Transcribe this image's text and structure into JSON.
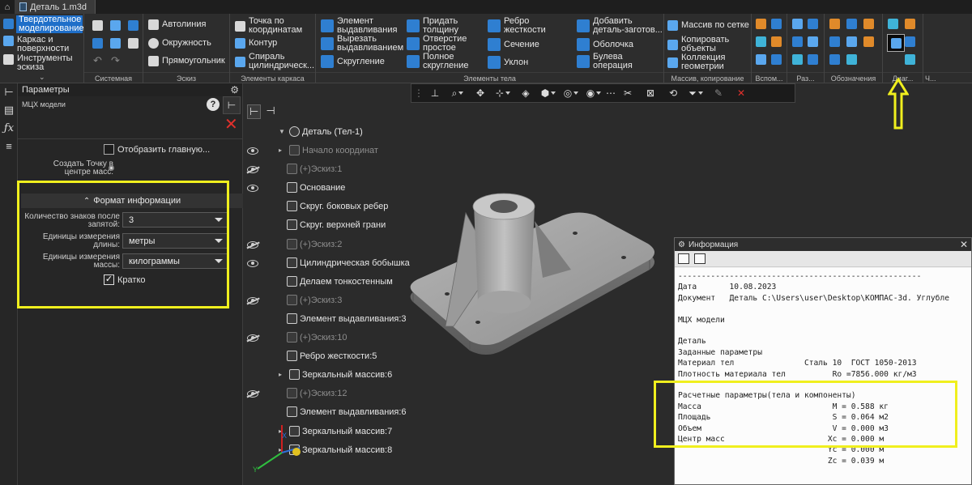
{
  "titlebar": {
    "tab": "Деталь 1.m3d"
  },
  "ribbon": {
    "mode": {
      "active": "Твердотельное моделирование",
      "items": [
        "Каркас и поверхности",
        "Инструменты эскиза"
      ]
    },
    "system": {
      "footer": "Системная"
    },
    "sketch": {
      "footer": "Эскиз",
      "buttons": [
        "Автолиния",
        "Окружность",
        "Прямоугольник"
      ]
    },
    "frame": {
      "footer": "Элементы каркаса",
      "buttons": [
        "Точка по координатам",
        "Контур",
        "Спираль цилиндрическ..."
      ]
    },
    "body": {
      "footer": "Элементы тела",
      "col1": [
        "Элемент выдавливания",
        "Вырезать выдавливанием",
        "Скругление"
      ],
      "col2": [
        "Придать толщину",
        "Отверстие простое",
        "Полное скругление"
      ],
      "col3": [
        "Ребро жесткости",
        "Сечение",
        "Уклон"
      ],
      "col4": [
        "Добавить деталь-заготов...",
        "Оболочка",
        "Булева операция"
      ]
    },
    "array": {
      "footer": "Массив, копирование",
      "buttons": [
        "Массив по сетке",
        "Копировать объекты",
        "Коллекция геометрии"
      ]
    },
    "aux": {
      "footer": "Вспом..."
    },
    "sizes": {
      "footer": "Раз..."
    },
    "notes": {
      "footer": "Обозначения"
    },
    "diag": {
      "footer": "Диаг..."
    },
    "ch": {
      "footer": "Ч..."
    }
  },
  "params": {
    "header": "Параметры",
    "subtitle": "МЦХ модели",
    "show_main": "Отобразить главную...",
    "create_point": "Создать Точку в центре масс:",
    "section": "Формат информации",
    "fields": [
      {
        "label": "Количество знаков после запятой:",
        "value": "3"
      },
      {
        "label": "Единицы измерения длины:",
        "value": "метры"
      },
      {
        "label": "Единицы измерения массы:",
        "value": "килограммы"
      }
    ],
    "brief": "Кратко"
  },
  "tree": {
    "root": "Деталь (Тел-1)",
    "nodes": [
      {
        "label": "Начало координат",
        "dim": true
      },
      {
        "label": "(+)Эскиз:1",
        "dim": true
      },
      {
        "label": "Основание",
        "dim": false
      },
      {
        "label": "Скруг. боковых ребер",
        "dim": false
      },
      {
        "label": "Скруг. верхней грани",
        "dim": false
      },
      {
        "label": "(+)Эскиз:2",
        "dim": true
      },
      {
        "label": "Цилиндрическая бобышка",
        "dim": false
      },
      {
        "label": "Делаем тонкостенным",
        "dim": false
      },
      {
        "label": "(+)Эскиз:3",
        "dim": true
      },
      {
        "label": "Элемент выдавливания:3",
        "dim": false
      },
      {
        "label": "(+)Эскиз:10",
        "dim": true
      },
      {
        "label": "Ребро жесткости:5",
        "dim": false
      },
      {
        "label": "Зеркальный массив:6",
        "dim": false
      },
      {
        "label": "(+)Эскиз:12",
        "dim": true
      },
      {
        "label": "Элемент выдавливания:6",
        "dim": false
      },
      {
        "label": "Зеркальный массив:7",
        "dim": false
      },
      {
        "label": "Зеркальный массив:8",
        "dim": false
      }
    ]
  },
  "axis": {
    "x": "X",
    "y": "Y"
  },
  "info": {
    "title": "Информация",
    "lines": [
      "----------------------------------------------------",
      "Дата       10.08.2023",
      "Документ   Деталь C:\\Users\\user\\Desktop\\КОМПАС-3d. Углубле",
      "",
      "МЦХ модели",
      "",
      "Деталь",
      "Заданные параметры",
      "Материал тел               Сталь 10  ГОСТ 1050-2013",
      "Плотность материала тел          Ro =7856.000 кг/м3",
      "",
      "Расчетные параметры(тела и компоненты)",
      "Масса                            M = 0.588 кг",
      "Площадь                          S = 0.064 м2",
      "Объем                            V = 0.000 м3",
      "Центр масс                      Xc = 0.000 м",
      "                                Yc = 0.000 м",
      "                                Zc = 0.039 м"
    ]
  },
  "colors": {
    "highlight": "#f0ef1e",
    "accent": "#1f6fc9",
    "close": "#e0302c"
  }
}
